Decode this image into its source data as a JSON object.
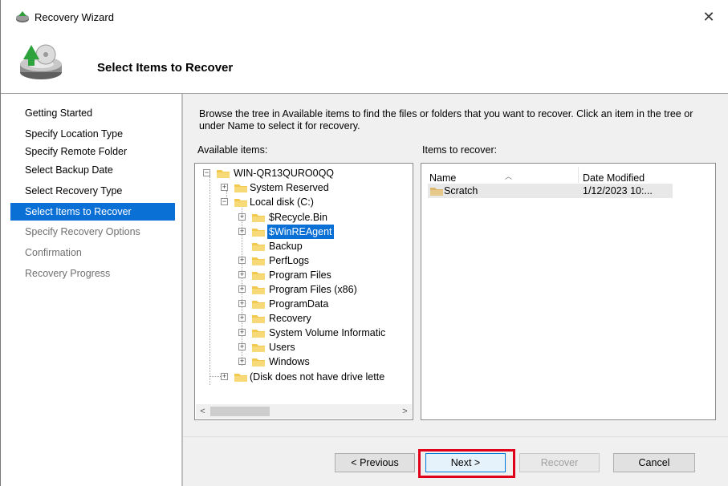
{
  "window": {
    "title": "Recovery Wizard",
    "close_glyph": "✕"
  },
  "header": {
    "page_title": "Select Items to Recover",
    "icon": "backup-drive-icon"
  },
  "nav": {
    "items": [
      {
        "label": "Getting Started",
        "state": "done"
      },
      {
        "label": "Specify Location Type",
        "state": "done"
      },
      {
        "label": "Specify Remote Folder",
        "state": "done"
      },
      {
        "label": "Select Backup Date",
        "state": "done"
      },
      {
        "label": "Select Recovery Type",
        "state": "done"
      },
      {
        "label": "Select Items to Recover",
        "state": "selected"
      },
      {
        "label": "Specify Recovery Options",
        "state": "pending"
      },
      {
        "label": "Confirmation",
        "state": "pending"
      },
      {
        "label": "Recovery Progress",
        "state": "pending"
      }
    ]
  },
  "main": {
    "description": "Browse the tree in Available items to find the files or folders that you want to recover. Click an item in the tree or under Name to select it for recovery.",
    "available_label": "Available items:",
    "recover_label": "Items to recover:",
    "tree": {
      "server": "WIN-QR13QURO0QQ",
      "system_reserved": "System Reserved",
      "local_disk": "Local disk (C:)",
      "folders": [
        "$Recycle.Bin",
        "$WinREAgent",
        "Backup",
        "PerfLogs",
        "Program Files",
        "Program Files (x86)",
        "ProgramData",
        "Recovery",
        "System Volume Informatic",
        "Users",
        "Windows"
      ],
      "selected_folder": "$WinREAgent",
      "no_letter": "(Disk does not have drive lette"
    },
    "list": {
      "columns": {
        "name": "Name",
        "date": "Date Modified"
      },
      "rows": [
        {
          "name": "Scratch",
          "date": "1/12/2023 10:..."
        }
      ]
    }
  },
  "footer": {
    "previous": "< Previous",
    "next": "Next >",
    "recover": "Recover",
    "cancel": "Cancel"
  },
  "colors": {
    "selection": "#0a70d6",
    "highlight_box": "#e0001a",
    "folder": "#f2c94c"
  }
}
